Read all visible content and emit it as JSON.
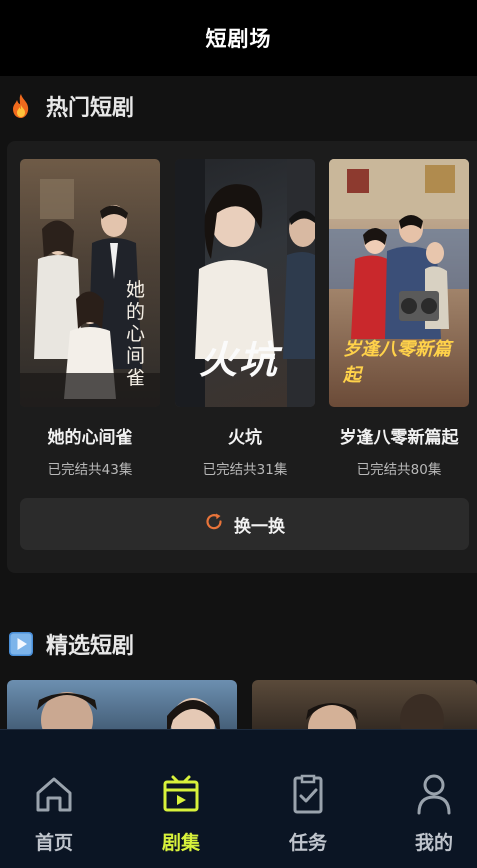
{
  "header": {
    "title": "短剧场"
  },
  "hot_section": {
    "title": "热门短剧",
    "dramas": [
      {
        "name": "她的心间雀",
        "status": "已完结共43集",
        "poster_text": "她的心间雀"
      },
      {
        "name": "火坑",
        "status": "已完结共31集",
        "poster_text": "火坑"
      },
      {
        "name": "岁逢八零新篇起",
        "status": "已完结共80集",
        "poster_text": "岁逢八零新篇起"
      }
    ],
    "refresh_label": "换一换"
  },
  "featured_section": {
    "title": "精选短剧"
  },
  "bottom_nav": {
    "items": [
      {
        "label": "首页",
        "icon": "home-icon",
        "active": false
      },
      {
        "label": "剧集",
        "icon": "play-screen-icon",
        "active": true
      },
      {
        "label": "任务",
        "icon": "task-clipboard-icon",
        "active": false
      },
      {
        "label": "我的",
        "icon": "profile-icon",
        "active": false
      }
    ]
  },
  "colors": {
    "accent": "#d8f23b",
    "refresh_icon": "#e8743a",
    "nav_bg": "#0b1524"
  }
}
